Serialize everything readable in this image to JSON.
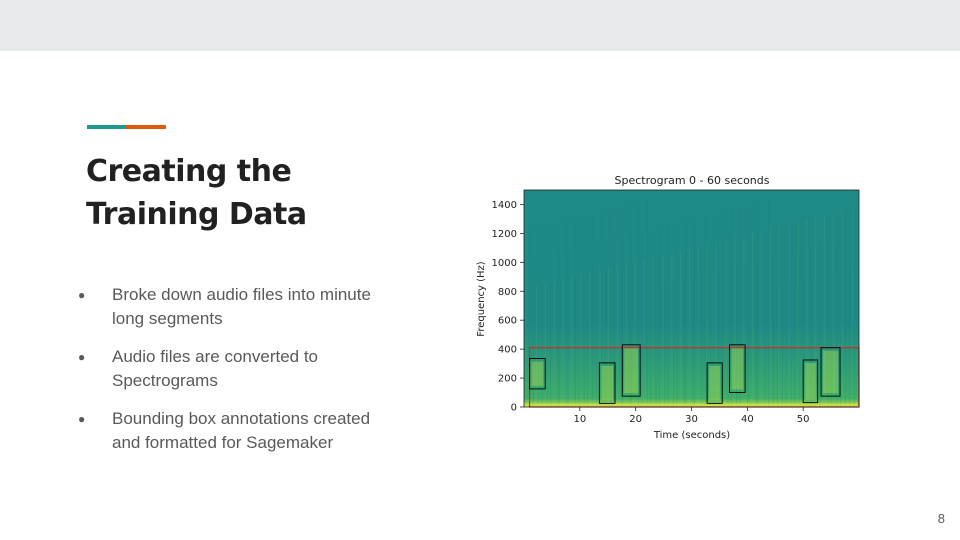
{
  "slide": {
    "title_lines": [
      "Creating the",
      "Training Data"
    ],
    "page_number": "8",
    "accent_colors": {
      "teal": "#1c9b8e",
      "orange": "#e05a0c"
    },
    "bullet_symbol": "●",
    "bullets": [
      {
        "lines": [
          "Broke down audio files into minute",
          "long segments"
        ]
      },
      {
        "lines": [
          "Audio files are converted to",
          "Spectrograms"
        ]
      },
      {
        "lines": [
          "Bounding box annotations created",
          "and formatted for Sagemaker"
        ]
      }
    ]
  },
  "chart_data": {
    "type": "heatmap",
    "title": "Spectrogram 0 - 60 seconds",
    "xlabel": "Time (seconds)",
    "ylabel": "Frequency (Hz)",
    "xlim": [
      0,
      60
    ],
    "ylim": [
      0,
      1500
    ],
    "x_ticks": [
      10,
      20,
      30,
      40,
      50
    ],
    "y_ticks": [
      0,
      200,
      400,
      600,
      800,
      1000,
      1200,
      1400
    ],
    "colors": {
      "background": "#1f8a85",
      "low_band": "#3fae6a",
      "hot": "#c9e245",
      "box_outline": "#000000",
      "region_outline": "#d62728"
    },
    "region_box": {
      "t0": 1,
      "t1": 60,
      "f0": 0,
      "f1": 410
    },
    "bounding_boxes": [
      {
        "t0": 1.0,
        "t1": 3.8,
        "f0": 125,
        "f1": 335
      },
      {
        "t0": 13.5,
        "t1": 16.3,
        "f0": 25,
        "f1": 305
      },
      {
        "t0": 17.6,
        "t1": 20.8,
        "f0": 75,
        "f1": 430
      },
      {
        "t0": 32.8,
        "t1": 35.5,
        "f0": 25,
        "f1": 305
      },
      {
        "t0": 36.8,
        "t1": 39.6,
        "f0": 100,
        "f1": 430
      },
      {
        "t0": 50.0,
        "t1": 52.6,
        "f0": 30,
        "f1": 325
      },
      {
        "t0": 53.2,
        "t1": 56.6,
        "f0": 75,
        "f1": 410
      }
    ]
  }
}
